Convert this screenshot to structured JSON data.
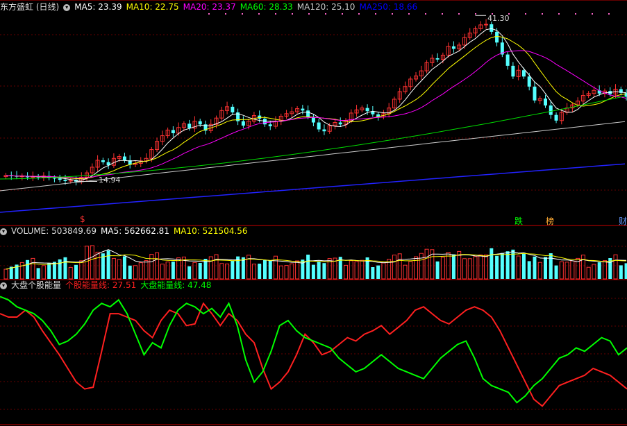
{
  "panel_price": {
    "title": "东方盛虹 (日线)",
    "ma_items": [
      {
        "text": "MA5: 23.39",
        "color": "#ffffff"
      },
      {
        "text": "MA10: 22.75",
        "color": "#ffff00"
      },
      {
        "text": "MA20: 23.37",
        "color": "#ff00ff"
      },
      {
        "text": "MA60: 28.33",
        "color": "#00ff00"
      },
      {
        "text": "MA120: 25.10",
        "color": "#cccccc"
      },
      {
        "text": "MA250: 18.66",
        "color": "#0000ff"
      }
    ],
    "high_label": "41.30",
    "low_label": "14.94",
    "markers": [
      {
        "text": "$",
        "color": "#ff3333"
      },
      {
        "text": "跌",
        "color": "#00ff00"
      },
      {
        "text": "榜",
        "color": "#ffaa33"
      },
      {
        "text": "财",
        "color": "#6699ff"
      }
    ]
  },
  "panel_volume": {
    "title": "VOLUME: 503849.69",
    "ma5": "MA5: 562662.81",
    "ma10": "MA10: 521504.56"
  },
  "panel_energy": {
    "title": "大盘个股能量",
    "line1": "个股能量线: 27.51",
    "line2": "大盘能量线: 47.48"
  },
  "chart_data": [
    {
      "type": "candlestick",
      "title": "东方盛虹 (日线)",
      "high_marker": 41.3,
      "low_marker": 14.94,
      "close_approx": [
        15.9,
        15.8,
        15.7,
        15.8,
        15.6,
        15.7,
        15.6,
        15.8,
        15.5,
        15.4,
        15.2,
        15.0,
        15.1,
        14.9,
        15.6,
        16.3,
        17.2,
        18.3,
        18.0,
        17.5,
        18.6,
        18.9,
        18.3,
        17.6,
        17.8,
        18.2,
        18.6,
        20.0,
        21.3,
        22.2,
        23.1,
        22.6,
        23.5,
        24.1,
        23.4,
        24.5,
        24.0,
        23.0,
        24.0,
        25.0,
        26.2,
        26.8,
        25.9,
        24.5,
        23.8,
        24.5,
        25.4,
        24.9,
        24.0,
        23.7,
        24.5,
        25.3,
        25.7,
        26.0,
        26.5,
        26.2,
        25.2,
        24.3,
        23.2,
        22.9,
        23.8,
        24.3,
        24.0,
        24.6,
        25.8,
        26.3,
        26.6,
        26.1,
        25.6,
        25.2,
        25.7,
        26.6,
        28.0,
        29.2,
        30.0,
        31.2,
        31.7,
        32.5,
        33.8,
        34.5,
        34.3,
        35.0,
        36.4,
        36.0,
        36.6,
        37.8,
        38.5,
        39.2,
        39.8,
        39.9,
        38.7,
        37.0,
        35.1,
        33.3,
        31.6,
        32.6,
        31.6,
        30.0,
        27.8,
        28.1,
        27.0,
        25.5,
        24.6,
        25.9,
        26.6,
        27.1,
        27.7,
        28.6,
        28.9,
        29.4,
        28.9,
        29.3,
        28.8,
        29.6,
        29.0,
        28.4
      ],
      "moving_averages": {
        "MA5": 23.39,
        "MA10": 22.75,
        "MA20": 23.37,
        "MA60": 28.33,
        "MA120": 25.1,
        "MA250": 18.66
      }
    },
    {
      "type": "bar",
      "title": "VOLUME",
      "latest": 503849.69,
      "ma5": 562662.81,
      "ma10": 521504.56
    },
    {
      "type": "line",
      "title": "大盘个股能量",
      "series": [
        {
          "name": "个股能量线",
          "color": "#ff2020",
          "latest": 27.51,
          "values": [
            62,
            60,
            60,
            64,
            60,
            52,
            45,
            38,
            30,
            22,
            18,
            19,
            40,
            62,
            62,
            60,
            58,
            52,
            48,
            58,
            64,
            62,
            55,
            56,
            68,
            62,
            55,
            62,
            58,
            50,
            45,
            30,
            18,
            22,
            28,
            38,
            50,
            45,
            38,
            40,
            44,
            48,
            46,
            50,
            52,
            55,
            50,
            54,
            58,
            64,
            66,
            62,
            58,
            56,
            60,
            64,
            66,
            64,
            60,
            52,
            42,
            32,
            22,
            12,
            8,
            14,
            20,
            22,
            24,
            26,
            30,
            28,
            26,
            22,
            18
          ]
        },
        {
          "name": "大盘能量线",
          "color": "#00ff00",
          "latest": 47.48,
          "values": [
            72,
            70,
            66,
            64,
            62,
            58,
            52,
            44,
            46,
            50,
            56,
            64,
            68,
            66,
            70,
            62,
            50,
            38,
            45,
            42,
            55,
            64,
            68,
            66,
            62,
            65,
            60,
            68,
            55,
            35,
            22,
            28,
            40,
            55,
            58,
            52,
            48,
            46,
            44,
            42,
            36,
            32,
            28,
            30,
            34,
            38,
            34,
            30,
            28,
            26,
            24,
            30,
            36,
            40,
            44,
            46,
            36,
            24,
            20,
            18,
            16,
            10,
            14,
            20,
            24,
            30,
            36,
            38,
            42,
            40,
            44,
            48,
            46,
            38,
            42
          ]
        }
      ]
    }
  ]
}
